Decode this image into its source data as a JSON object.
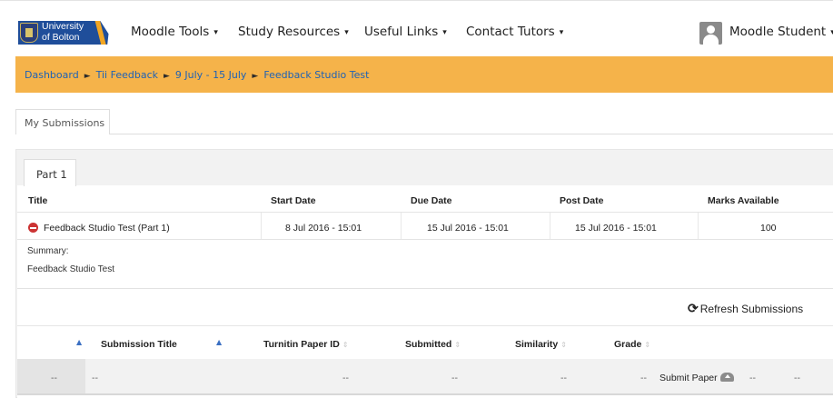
{
  "navbar": {
    "logo_line1": "University",
    "logo_line2": "of Bolton",
    "menu": [
      {
        "label": "Moodle Tools"
      },
      {
        "label": "Study Resources"
      },
      {
        "label": "Useful Links"
      },
      {
        "label": "Contact Tutors"
      }
    ],
    "user_label": "Moodle Student",
    "caret": "▾"
  },
  "breadcrumb": {
    "items": [
      "Dashboard",
      "Tii Feedback",
      "9 July - 15 July",
      "Feedback Studio Test"
    ],
    "separator": "►"
  },
  "tabs": {
    "my_submissions": "My Submissions",
    "part": "Part 1"
  },
  "assignment": {
    "headers": {
      "title": "Title",
      "start": "Start Date",
      "due": "Due Date",
      "post": "Post Date",
      "marks": "Marks Available"
    },
    "row": {
      "title": "Feedback Studio Test (Part 1)",
      "start": "8 Jul 2016 - 15:01",
      "due": "15 Jul 2016 - 15:01",
      "post": "15 Jul 2016 - 15:01",
      "marks": "100"
    },
    "summary_label": "Summary:",
    "summary_text": "Feedback Studio Test"
  },
  "submissions": {
    "refresh_label": "Refresh Submissions",
    "headers": {
      "title": "Submission Title",
      "paper_id": "Turnitin Paper ID",
      "submitted": "Submitted",
      "similarity": "Similarity",
      "grade": "Grade"
    },
    "sort_up": "▲",
    "sort_both": "⇕",
    "dash": "--",
    "submit_label": "Submit Paper"
  },
  "colors": {
    "breadcrumb_bg": "#f5b34a",
    "link": "#1e62b6",
    "brand": "#1f4e9a",
    "accent": "#f2a623",
    "remove_icon": "#cc3333"
  },
  "icons": [
    "user-avatar-icon",
    "remove-circle-icon",
    "refresh-icon",
    "cloud-upload-icon",
    "sort-icon"
  ]
}
